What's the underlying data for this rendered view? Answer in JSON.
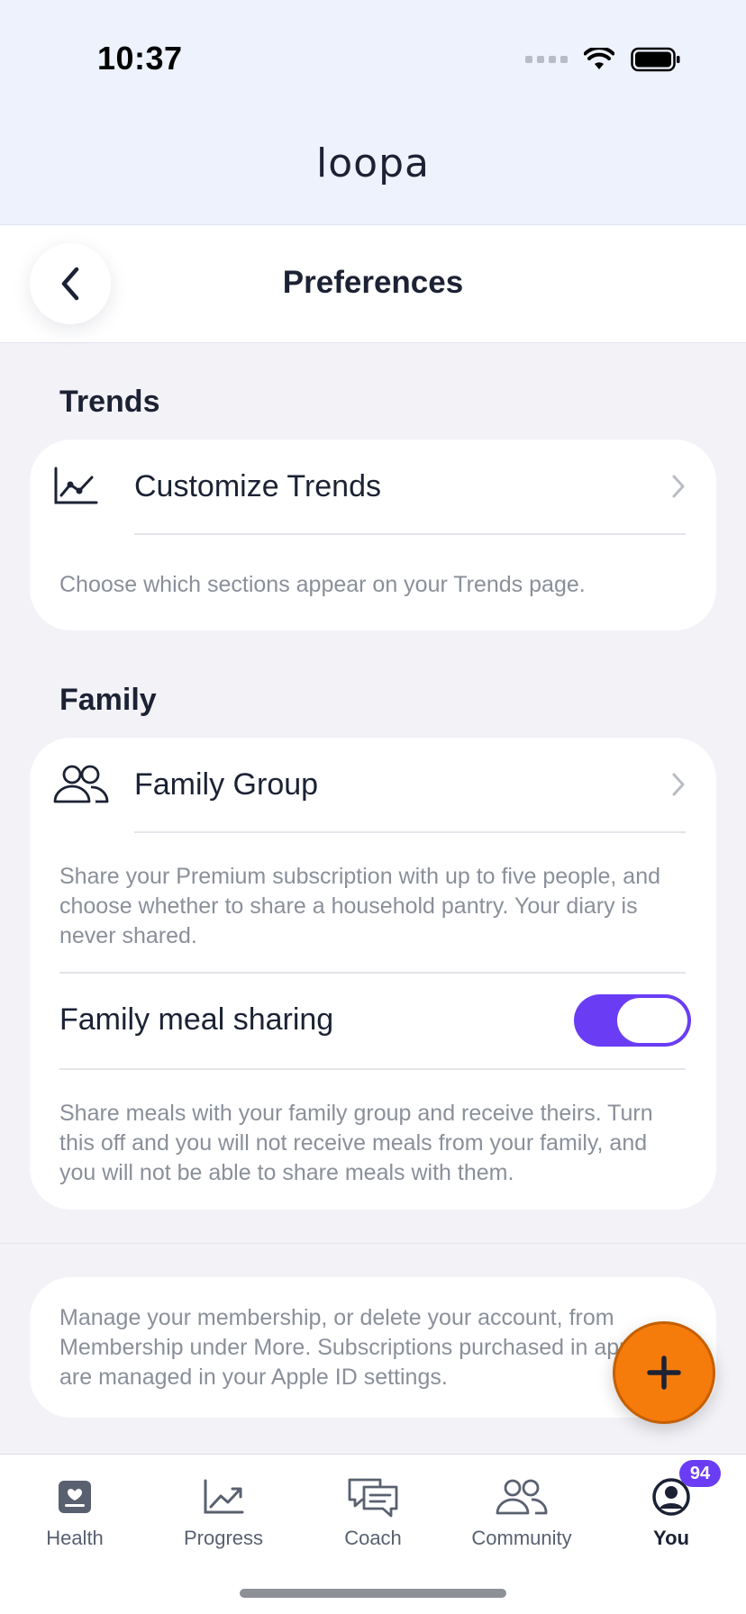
{
  "status_bar": {
    "time": "10:37"
  },
  "app": {
    "logo_text": "loopa"
  },
  "header": {
    "title": "Preferences",
    "back_icon": "chevron-left-icon"
  },
  "sections": {
    "trends": {
      "title": "Trends",
      "row_label": "Customize Trends",
      "description": "Choose which sections appear on your Trends page."
    },
    "family": {
      "title": "Family",
      "group_label": "Family Group",
      "group_description": "Share your Premium subscription with up to five people, and choose whether to share a household pantry. Your diary is never shared.",
      "meal_sharing_label": "Family meal sharing",
      "meal_sharing_enabled": true,
      "meal_sharing_description": "Share meals with your family group and receive theirs. Turn this off and you will not receive meals from your family, and you will not be able to share meals with them."
    },
    "membership": {
      "note": "Manage your membership, or delete your account, from Membership under More. Subscriptions purchased in app are managed in your Apple ID settings."
    }
  },
  "fab": {
    "icon": "plus-icon"
  },
  "tabbar": {
    "tabs": [
      {
        "label": "Health",
        "icon": "health-icon"
      },
      {
        "label": "Progress",
        "icon": "chart-icon"
      },
      {
        "label": "Coach",
        "icon": "chat-icon"
      },
      {
        "label": "Community",
        "icon": "people-icon"
      },
      {
        "label": "You",
        "icon": "profile-icon",
        "badge": "94",
        "active": true
      }
    ]
  },
  "colors": {
    "accent": "#6a3df5",
    "fab": "#f57c0a",
    "text": "#1c2234",
    "muted": "#8a8f99"
  }
}
